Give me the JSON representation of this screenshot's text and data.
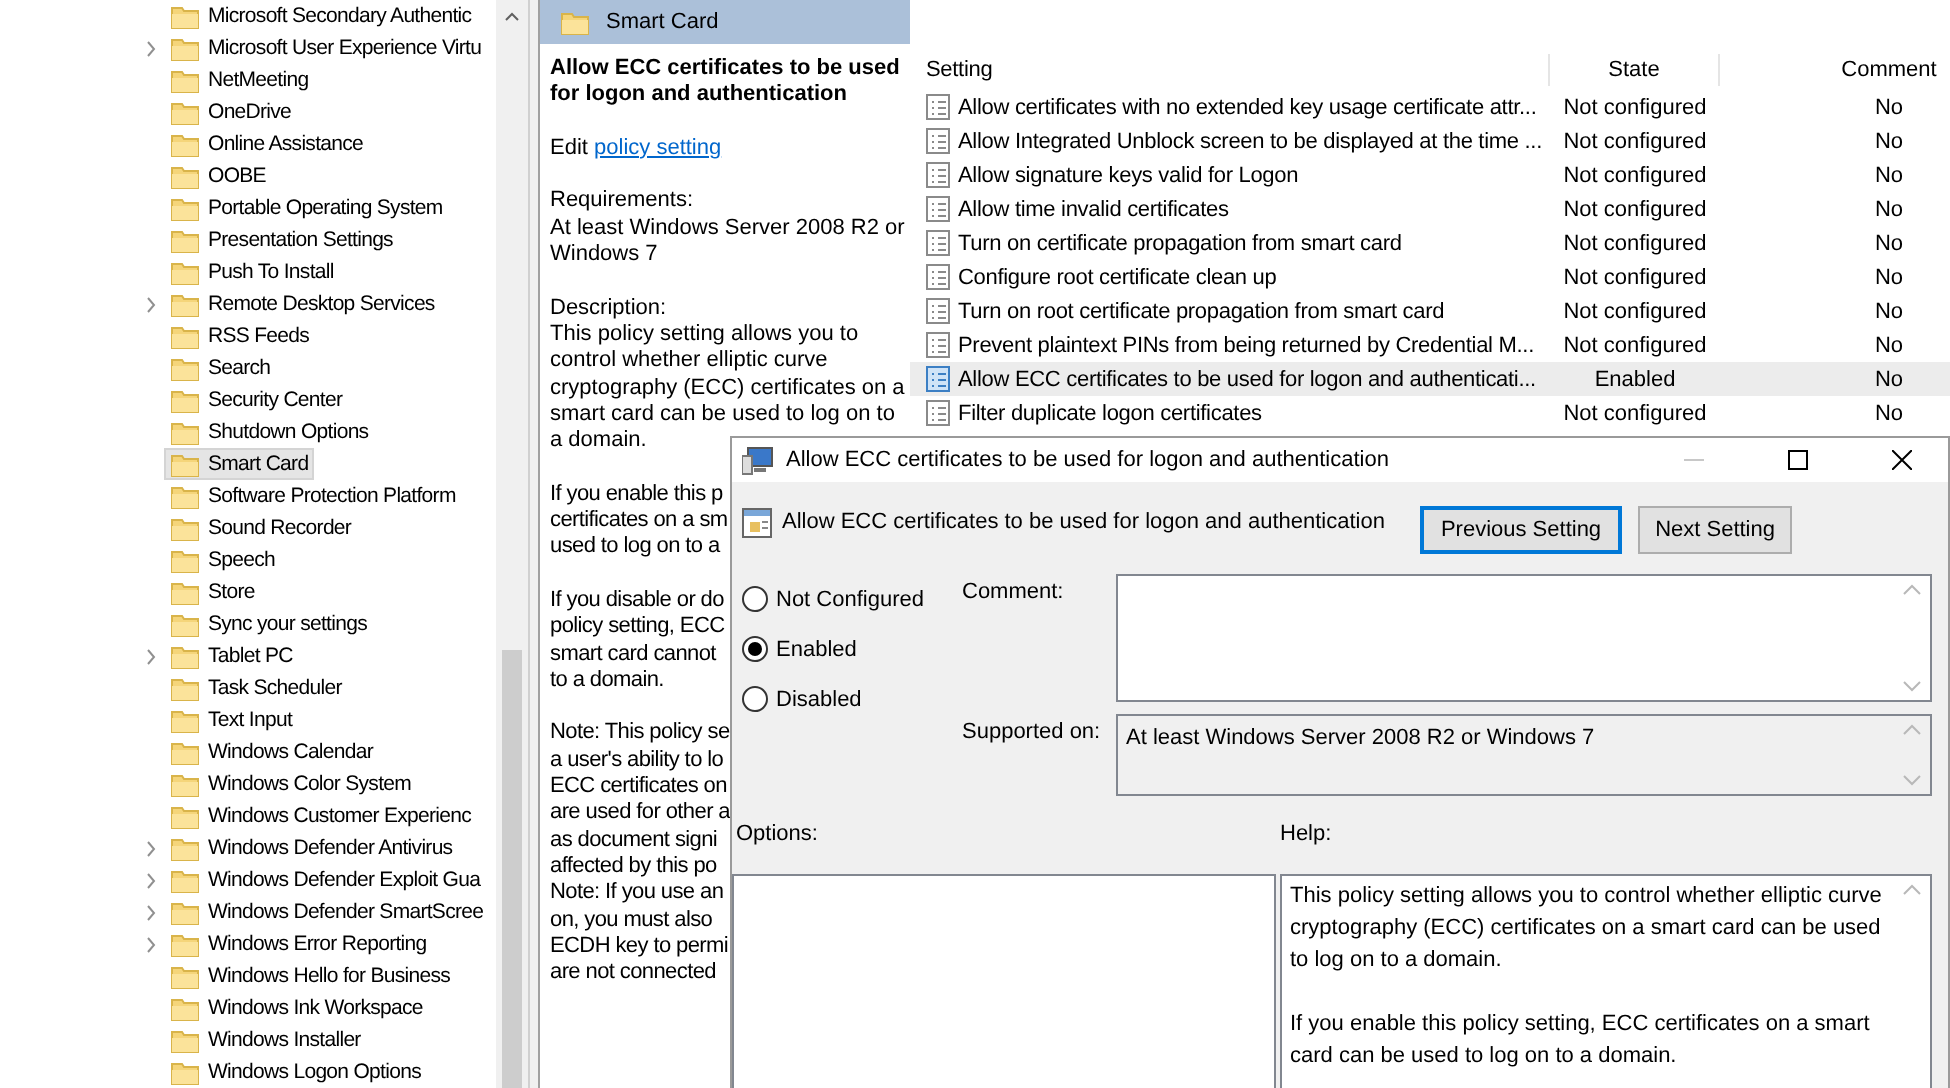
{
  "tree": {
    "items": [
      {
        "label": "Microsoft Secondary Authentic",
        "expandable": false,
        "selected": false
      },
      {
        "label": "Microsoft User Experience Virtu",
        "expandable": true,
        "selected": false
      },
      {
        "label": "NetMeeting",
        "expandable": false,
        "selected": false
      },
      {
        "label": "OneDrive",
        "expandable": false,
        "selected": false
      },
      {
        "label": "Online Assistance",
        "expandable": false,
        "selected": false
      },
      {
        "label": "OOBE",
        "expandable": false,
        "selected": false
      },
      {
        "label": "Portable Operating System",
        "expandable": false,
        "selected": false
      },
      {
        "label": "Presentation Settings",
        "expandable": false,
        "selected": false
      },
      {
        "label": "Push To Install",
        "expandable": false,
        "selected": false
      },
      {
        "label": "Remote Desktop Services",
        "expandable": true,
        "selected": false
      },
      {
        "label": "RSS Feeds",
        "expandable": false,
        "selected": false
      },
      {
        "label": "Search",
        "expandable": false,
        "selected": false
      },
      {
        "label": "Security Center",
        "expandable": false,
        "selected": false
      },
      {
        "label": "Shutdown Options",
        "expandable": false,
        "selected": false
      },
      {
        "label": "Smart Card",
        "expandable": false,
        "selected": true
      },
      {
        "label": "Software Protection Platform",
        "expandable": false,
        "selected": false
      },
      {
        "label": "Sound Recorder",
        "expandable": false,
        "selected": false
      },
      {
        "label": "Speech",
        "expandable": false,
        "selected": false
      },
      {
        "label": "Store",
        "expandable": false,
        "selected": false
      },
      {
        "label": "Sync your settings",
        "expandable": false,
        "selected": false
      },
      {
        "label": "Tablet PC",
        "expandable": true,
        "selected": false
      },
      {
        "label": "Task Scheduler",
        "expandable": false,
        "selected": false
      },
      {
        "label": "Text Input",
        "expandable": false,
        "selected": false
      },
      {
        "label": "Windows Calendar",
        "expandable": false,
        "selected": false
      },
      {
        "label": "Windows Color System",
        "expandable": false,
        "selected": false
      },
      {
        "label": "Windows Customer Experienc",
        "expandable": false,
        "selected": false
      },
      {
        "label": "Windows Defender Antivirus",
        "expandable": true,
        "selected": false
      },
      {
        "label": "Windows Defender Exploit Gua",
        "expandable": true,
        "selected": false
      },
      {
        "label": "Windows Defender SmartScree",
        "expandable": true,
        "selected": false
      },
      {
        "label": "Windows Error Reporting",
        "expandable": true,
        "selected": false
      },
      {
        "label": "Windows Hello for Business",
        "expandable": false,
        "selected": false
      },
      {
        "label": "Windows Ink Workspace",
        "expandable": false,
        "selected": false
      },
      {
        "label": "Windows Installer",
        "expandable": false,
        "selected": false
      },
      {
        "label": "Windows Logon Options",
        "expandable": false,
        "selected": false
      }
    ]
  },
  "details": {
    "header": "Smart Card",
    "title": "Allow ECC certificates to be used for logon and authentication",
    "edit_prefix": "Edit",
    "edit_link": "policy setting",
    "requirements_label": "Requirements:",
    "requirements": "At least Windows Server 2008 R2 or Windows 7",
    "description_label": "Description:",
    "description": "This policy setting allows you to control whether elliptic curve cryptography (ECC) certificates on a smart card can be used to log on to a domain.",
    "cut_paragraphs": [
      [
        "If you enable this p",
        "certificates on a sm",
        "used to log on to a"
      ],
      [
        "If you disable or do",
        "policy setting, ECC",
        "smart card cannot",
        "to a domain."
      ],
      [
        "Note: This policy se",
        "a user's ability to lo",
        "ECC certificates on",
        "are used for other a",
        "as document signi",
        "affected by this po",
        "Note: If you use an",
        "on, you must also",
        "ECDH key to permi",
        "are not connected"
      ]
    ]
  },
  "table": {
    "columns": [
      "Setting",
      "State",
      "Comment"
    ],
    "rows": [
      {
        "setting": "Allow certificates with no extended key usage certificate attr...",
        "state": "Not configured",
        "comment": "No",
        "selected": false
      },
      {
        "setting": "Allow Integrated Unblock screen to be displayed at the time ...",
        "state": "Not configured",
        "comment": "No",
        "selected": false
      },
      {
        "setting": "Allow signature keys valid for Logon",
        "state": "Not configured",
        "comment": "No",
        "selected": false
      },
      {
        "setting": "Allow time invalid certificates",
        "state": "Not configured",
        "comment": "No",
        "selected": false
      },
      {
        "setting": "Turn on certificate propagation from smart card",
        "state": "Not configured",
        "comment": "No",
        "selected": false
      },
      {
        "setting": "Configure root certificate clean up",
        "state": "Not configured",
        "comment": "No",
        "selected": false
      },
      {
        "setting": "Turn on root certificate propagation from smart card",
        "state": "Not configured",
        "comment": "No",
        "selected": false
      },
      {
        "setting": "Prevent plaintext PINs from being returned by Credential M...",
        "state": "Not configured",
        "comment": "No",
        "selected": false
      },
      {
        "setting": "Allow ECC certificates to be used for logon and authenticati...",
        "state": "Enabled",
        "comment": "No",
        "selected": true
      },
      {
        "setting": "Filter duplicate logon certificates",
        "state": "Not configured",
        "comment": "No",
        "selected": false
      }
    ]
  },
  "dialog": {
    "title": "Allow ECC certificates to be used for logon and authentication",
    "setting_name": "Allow ECC certificates to be used for logon and authentication",
    "buttons": [
      {
        "label": "Previous Setting",
        "focused": true
      },
      {
        "label": "Next Setting",
        "focused": false
      }
    ],
    "state_options": [
      {
        "label": "Not Configured",
        "selected": false
      },
      {
        "label": "Enabled",
        "selected": true
      },
      {
        "label": "Disabled",
        "selected": false
      }
    ],
    "comment_label": "Comment:",
    "supported_label": "Supported on:",
    "supported_value": "At least Windows Server 2008 R2 or Windows 7",
    "options_label": "Options:",
    "help_label": "Help:",
    "help": [
      "This policy setting allows you to control whether elliptic curve cryptography (ECC) certificates on a smart card can be used to log on to a domain.",
      "If you enable this policy setting, ECC certificates on a smart card can be used to log on to a domain."
    ]
  }
}
